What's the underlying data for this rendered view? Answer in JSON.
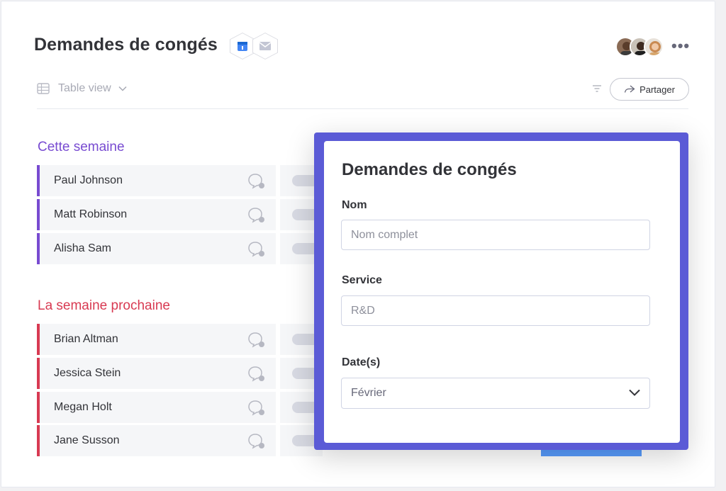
{
  "header": {
    "title": "Demandes de congés",
    "more_label": "•••"
  },
  "toolbar": {
    "view_label": "Table view",
    "share_label": "Partager"
  },
  "groups": [
    {
      "title": "Cette semaine",
      "color": "#784bd1",
      "items": [
        "Paul Johnson",
        "Matt Robinson",
        "Alisha Sam"
      ]
    },
    {
      "title": "La semaine prochaine",
      "color": "#d83a52",
      "items": [
        "Brian Altman",
        "Jessica Stein",
        "Megan Holt",
        "Jane Susson"
      ]
    }
  ],
  "form": {
    "title": "Demandes de congés",
    "name_label": "Nom",
    "name_placeholder": "Nom complet",
    "service_label": "Service",
    "service_placeholder": "R&D",
    "date_label": "Date(s)",
    "date_value": "Février"
  },
  "colors": {
    "accent": "#5b5bd6",
    "primary_blue": "#579bfc"
  }
}
